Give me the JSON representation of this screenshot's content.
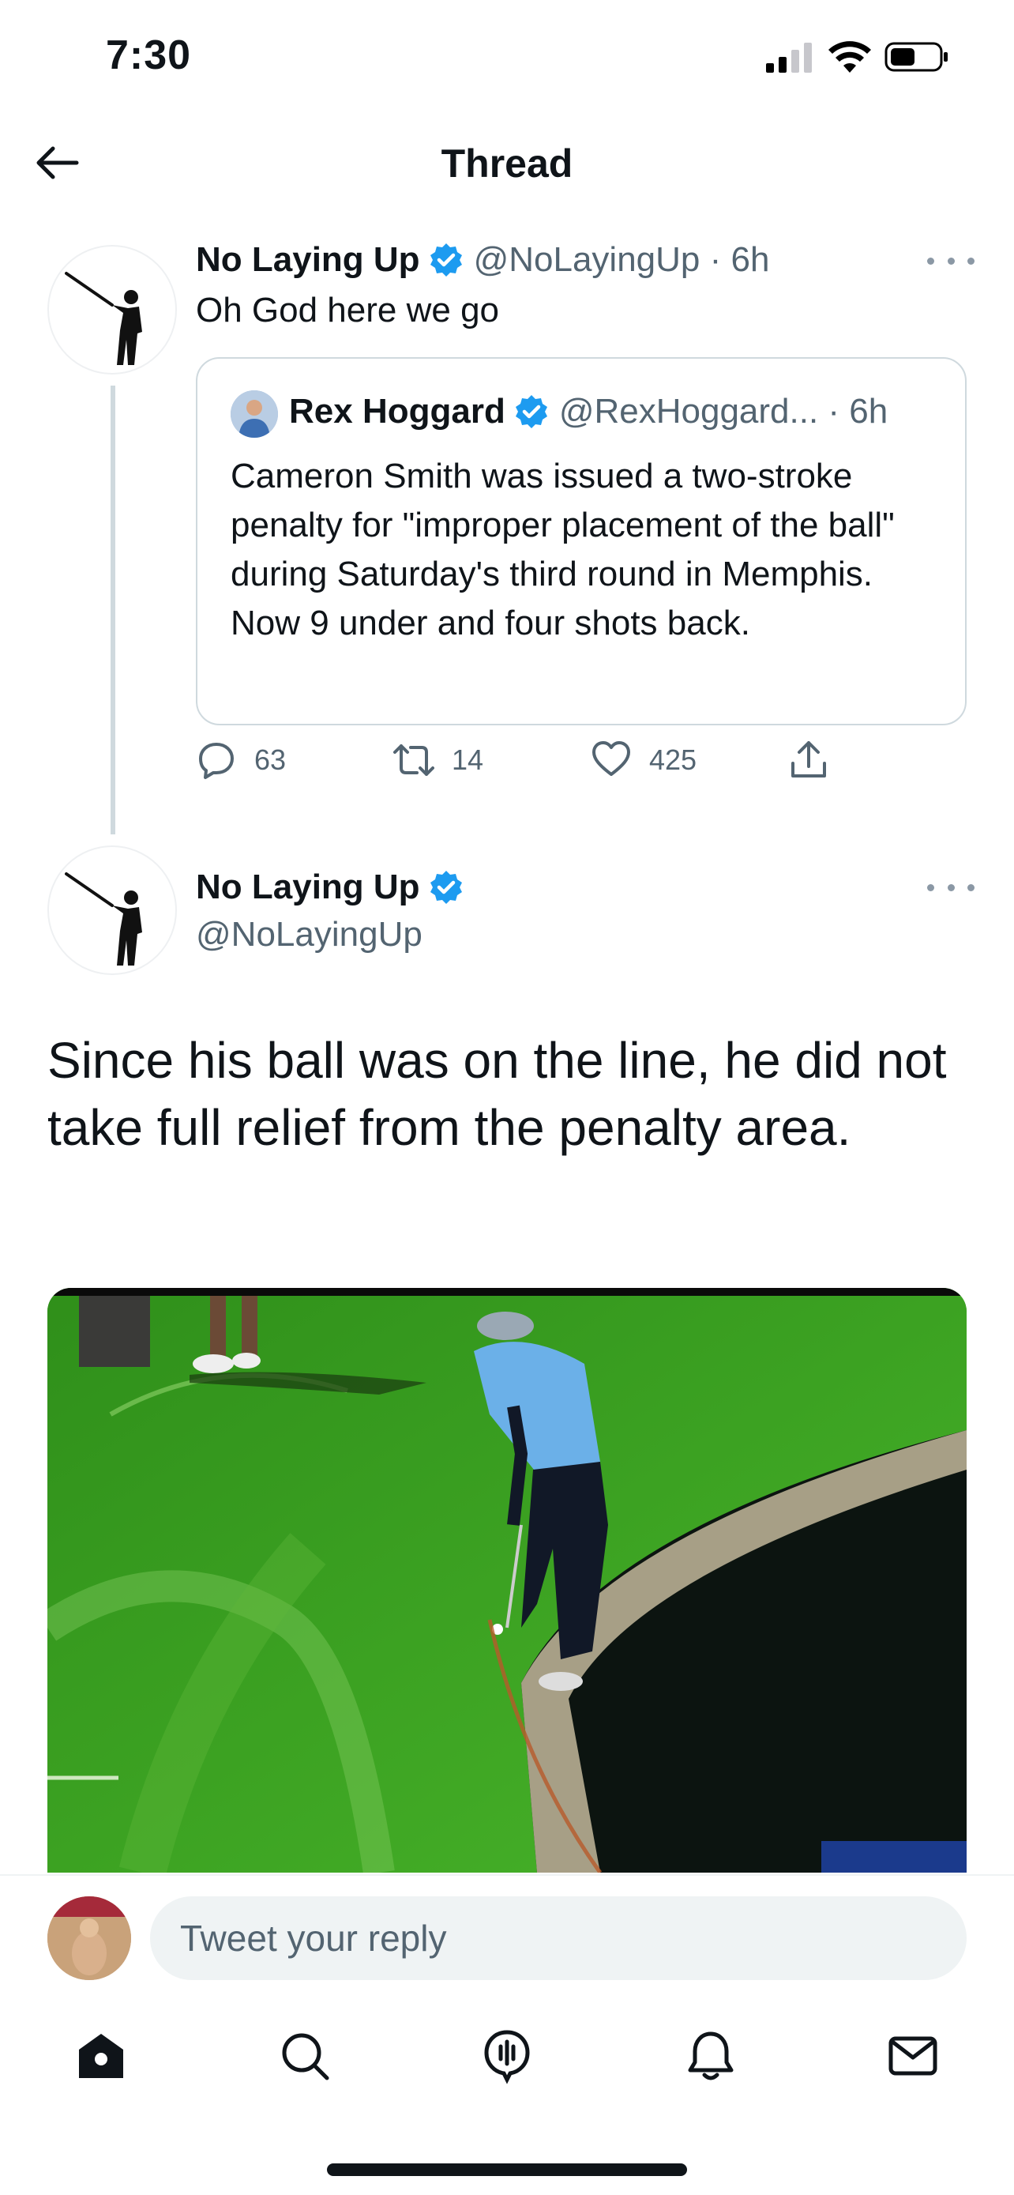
{
  "status_bar": {
    "time": "7:30"
  },
  "header": {
    "title": "Thread"
  },
  "tweet1": {
    "name": "No Laying Up",
    "handle_time": "@NoLayingUp · 6h",
    "text": "Oh God here we go",
    "quote": {
      "name": "Rex Hoggard",
      "handle_time": "@RexHoggard... · 6h",
      "text": "Cameron Smith was issued a two-stroke penalty for \"improper placement of the ball\" during Saturday's third round in Memphis. Now 9 under and four shots back."
    },
    "actions": {
      "replies": "63",
      "retweets": "14",
      "likes": "425"
    }
  },
  "tweet2": {
    "name": "No Laying Up",
    "handle": "@NoLayingUp",
    "text": "Since his ball was on the line, he did not take full relief from the penalty area."
  },
  "reply": {
    "placeholder": "Tweet your reply"
  },
  "tabs": [
    "home-icon",
    "search-icon",
    "spaces-icon",
    "notifications-icon",
    "messages-icon"
  ],
  "colors": {
    "verified": "#1d9bf0",
    "secondary_text": "#536471",
    "grass": "#3a9a1e"
  }
}
